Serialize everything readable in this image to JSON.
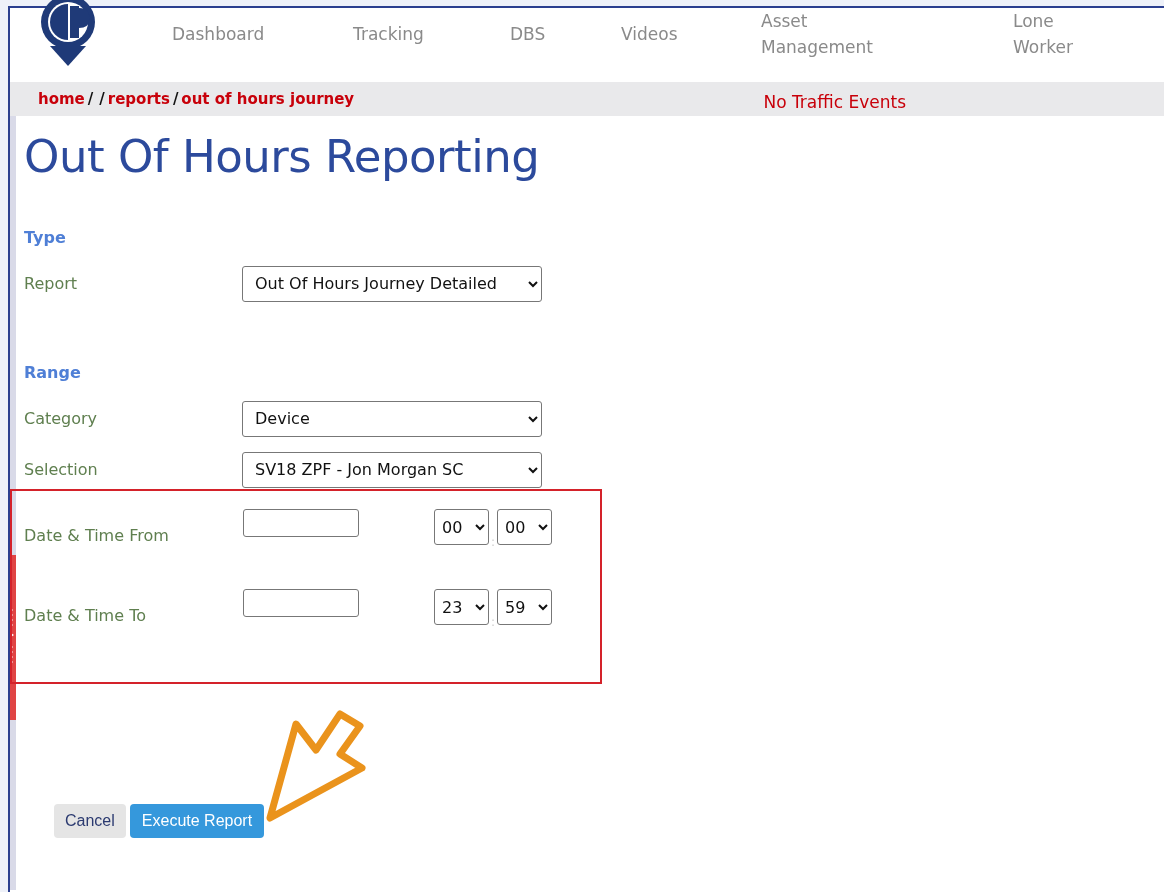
{
  "nav": {
    "items": [
      {
        "label": "Dashboard"
      },
      {
        "label": "Tracking"
      },
      {
        "label": "DBS"
      },
      {
        "label": "Videos"
      },
      {
        "label": "Asset Management"
      },
      {
        "label": "Lone Worker"
      }
    ]
  },
  "breadcrumb": [
    {
      "kind": "link",
      "label": "home"
    },
    {
      "kind": "separator",
      "label": "/"
    },
    {
      "kind": "separator",
      "label": "/"
    },
    {
      "kind": "link",
      "label": "reports"
    },
    {
      "kind": "separator",
      "label": "/"
    },
    {
      "kind": "link",
      "label": "out of hours journey"
    }
  ],
  "traffic_status": "No Traffic Events",
  "title": "Out Of Hours Reporting",
  "sections": [
    {
      "heading": "Type",
      "fields": [
        {
          "kind": "select",
          "label": "Report",
          "value": "Out Of Hours Journey Detailed"
        }
      ]
    },
    {
      "heading": "Range",
      "fields": [
        {
          "kind": "select",
          "label": "Category",
          "value": "Device"
        },
        {
          "kind": "select",
          "label": "Selection",
          "value": "SV18 ZPF - Jon Morgan SC"
        },
        {
          "kind": "datetime",
          "label": "Date & Time From",
          "hour": "00",
          "separator": ":",
          "minute": "00"
        },
        {
          "kind": "datetime",
          "label": "Date & Time To",
          "hour": "23",
          "separator": ":",
          "minute": "59"
        }
      ]
    }
  ],
  "buttons": [
    {
      "kind": "secondary",
      "label": "Cancel"
    },
    {
      "kind": "primary",
      "label": "Execute Report"
    }
  ],
  "annotations": {
    "highlight_frame": true,
    "pointer_arrow": true
  }
}
